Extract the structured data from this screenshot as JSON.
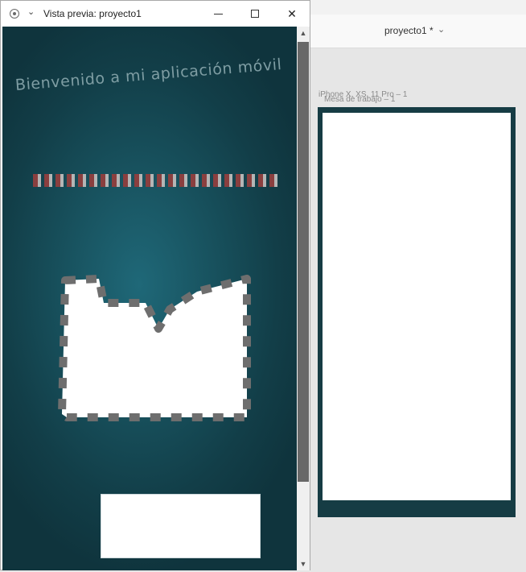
{
  "window": {
    "title": "Vista previa: proyecto1",
    "icons": {
      "record": "record-icon",
      "menu": "chevron-down-icon",
      "minimize": "minimize-icon",
      "maximize": "maximize-icon",
      "close": "close-icon"
    },
    "close_glyph": "✕",
    "menu_glyph": "⌄"
  },
  "preview": {
    "welcome_text": "Bienvenido a mi aplicación móvil",
    "background_color": "#1f6878",
    "dash_colors": [
      "#8a3f3f",
      "#b5b5b5"
    ],
    "shape_fill": "#ffffff",
    "shape_stroke": "#6e6e6e"
  },
  "scrollbar": {
    "up_glyph": "▲",
    "down_glyph": "▼"
  },
  "design_app": {
    "document_title": "proyecto1 *",
    "document_chevron": "⌄",
    "artboard_label_primary": "iPhone X, XS, 11 Pro – 1",
    "artboard_label_secondary": "Mesa de trabajo – 1",
    "artboard_color": "#163c44"
  }
}
